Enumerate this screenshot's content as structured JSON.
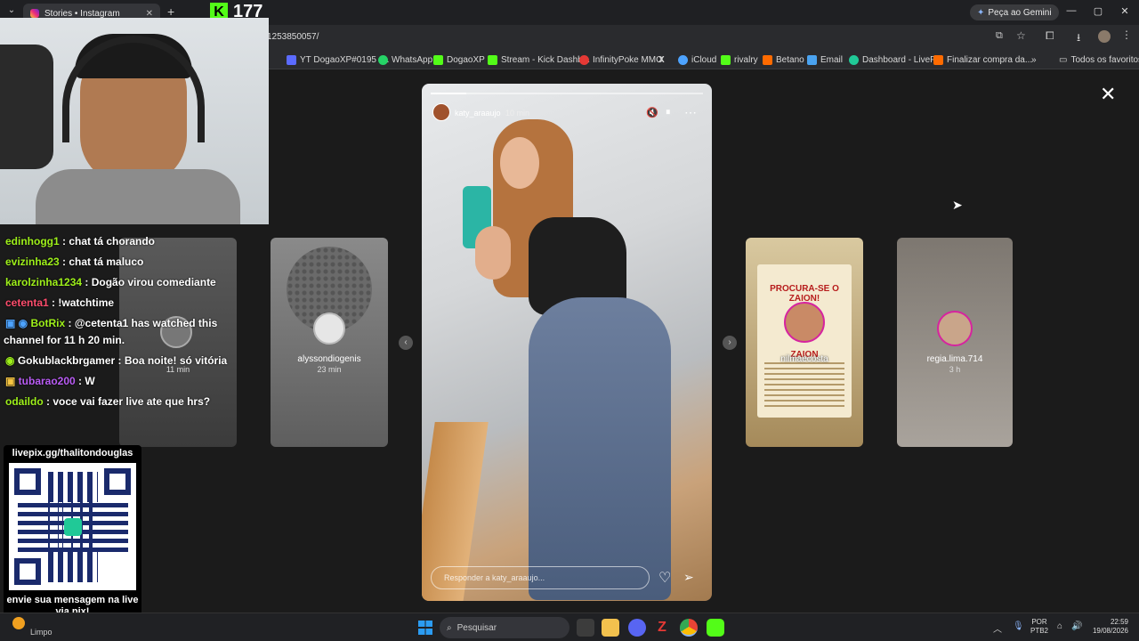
{
  "browser": {
    "tab_title": "Stories • Instagram",
    "address_fragment": "1253850057/",
    "gemini_label": "Peça ao Gemini",
    "kick_count": "177",
    "bookmarks": [
      {
        "label": "YT DogaoXP#0195 -...",
        "color": "#5b6bff"
      },
      {
        "label": "WhatsApp",
        "color": "#25d366"
      },
      {
        "label": "DogaoXP",
        "color": "#53fc18"
      },
      {
        "label": "Stream - Kick Dashb...",
        "color": "#53fc18"
      },
      {
        "label": "InfinityPoke MMO",
        "color": "#e53935"
      },
      {
        "label": "X",
        "color": "#ffffff"
      },
      {
        "label": "iCloud",
        "color": "#4da3ff"
      },
      {
        "label": "rivalry",
        "color": "#53fc18"
      },
      {
        "label": "Betano",
        "color": "#ff6b00"
      },
      {
        "label": "Email",
        "color": "#4aa3f0"
      },
      {
        "label": "Dashboard - LivePix",
        "color": "#20c997"
      },
      {
        "label": "Finalizar compra da...",
        "color": "#ff6b00"
      }
    ],
    "all_favorites": "Todos os favoritos"
  },
  "stories": {
    "main": {
      "username": "katy_araaujo",
      "time": "10 min",
      "reply_placeholder": "Responder a katy_araaujo..."
    },
    "left": [
      {
        "username": "alyssondiogenis",
        "time": "23 min"
      },
      {
        "username": "",
        "time": "11 min"
      }
    ],
    "right": [
      {
        "username": "nilmaecosta",
        "time": "",
        "poster_title": "PROCURA-SE O ZAION!",
        "poster_name": "ZAION"
      },
      {
        "username": "regia.lima.714",
        "time": "3 h"
      }
    ]
  },
  "chat": {
    "messages": [
      {
        "user": "edinhogg1",
        "text": " : chat tá chorando",
        "color": "#9ef01a"
      },
      {
        "user": "evizinha23",
        "text": " : chat tá maluco",
        "color": "#9ef01a"
      },
      {
        "user": "karolzinha1234",
        "text": " : Dogão virou comediante",
        "color": "#9ef01a"
      },
      {
        "user": "cetenta1",
        "text": " : !watchtime",
        "color": "#ff4d6d"
      },
      {
        "user": "BotRix",
        "text": " : @cetenta1 has watched this",
        "color": "#9ef01a"
      },
      {
        "user": "",
        "text": "channel for 11 h 20 min.",
        "color": "#ffffff"
      },
      {
        "user": "Gokublackbrgamer",
        "text": " : Boa noite! só vitória",
        "color": "#ffffff"
      },
      {
        "user": "tubarao200",
        "text": " : W",
        "color": "#b95cf4"
      },
      {
        "user": "odaildo",
        "text": " : voce vai fazer live ate que hrs?",
        "color": "#9ef01a"
      }
    ]
  },
  "qr": {
    "url": "livepix.gg/thalitondouglas",
    "caption": "envie sua mensagem na live via pix!"
  },
  "taskbar": {
    "weather": "Limpo",
    "search_placeholder": "Pesquisar",
    "lang": "POR",
    "lang2": "PTB2",
    "time": "22:59",
    "date": "19/08/2026"
  }
}
